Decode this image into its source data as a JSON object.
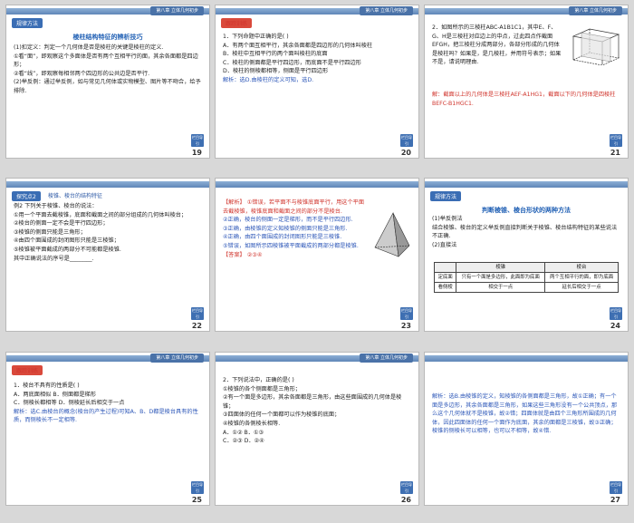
{
  "header_chapter": "第八章 立体几何初步",
  "slides": [
    {
      "tag": "规律方法",
      "title": "棱柱结构特征的辨析技巧",
      "lines": [
        "(1)扣定义：判定一个几何体是否是棱柱的关键是棱柱的定义.",
        "①看“面”，即观察这个多面体是否有两个互相平行的面，其余各面都是四边形；",
        "②看“线”，即观察每相邻两个四边形的公共边是否平行.",
        "(2)举反例：通过举反例，如与常见几何体或实物模型、图片等不吻合，给予排除."
      ],
      "back": "栏目导引",
      "page": "19"
    },
    {
      "tag": "跟踪训练",
      "lines": [
        "1．下列命题中正确的是(    )",
        "A．有两个面互相平行，其余各面都是四边形的几何体叫棱柱",
        "B．棱柱中互相平行的两个面叫棱柱的底面",
        "C．棱柱的侧面都是平行四边形，而底面不是平行四边形",
        "D．棱柱的侧棱都相等，侧面是平行四边形"
      ],
      "answer": "解析：选D.由棱柱的定义可知，选D.",
      "back": "栏目导引",
      "page": "20"
    },
    {
      "lines": [
        "2．如图所示的三棱柱ABC-A1B1C1，其中E、F、G、H是三棱柱对应边上的中点，过此四点作截面EFGH，把三棱柱分成两部分，各部分形成的几何体是棱柱吗？如果是，是几棱柱，并用符号表示；如果不是，请说明理由."
      ],
      "answer": "解：截面以上的几何体是三棱柱AEF-A1HG1，截面以下的几何体是四棱柱BEFC-B1HGC1.",
      "back": "栏目导引",
      "page": "21"
    },
    {
      "tag": "探究点2",
      "tag2": "棱锥、棱台的结构特征",
      "lines": [
        "例2  下列关于棱锥、棱台的说法：",
        "①用一个平面去截棱锥，底面和截面之间的部分组成的几何体叫棱台；",
        "②棱台的侧面一定不会是平行四边形；",
        "③棱锥的侧面只能是三角形；",
        "④由四个面围成的封闭图形只能是三棱锥；",
        "⑤棱锥被平面截成的两部分不可能都是棱锥.",
        "其中正确说法的序号是________."
      ],
      "back": "栏目导引",
      "page": "22"
    },
    {
      "lines": [
        "【解析】  ①错误，若平面不与棱锥底面平行，用这个平面去截棱锥，棱锥底面和截面之间的部分不是棱台.",
        "②正确，棱台的侧面一定是梯形，而不是平行四边形.",
        "③正确，由棱锥的定义知棱锥的侧面只能是三角形.",
        "④正确，由四个面围成的封闭图形只能是三棱锥.",
        "⑤错误，如图所示四棱锥被平面截成的两部分都是棱锥."
      ],
      "answer_label": "【答案】",
      "answer": "②③④",
      "back": "栏目导引",
      "page": "23"
    },
    {
      "tag": "规律方法",
      "title": "判断棱锥、棱台形状的两种方法",
      "lines": [
        "(1)举反例法",
        "结合棱锥、棱台的定义举反例直接判断关于棱锥、棱台结构特征的某些说法不正确.",
        "(2)直接法"
      ],
      "table": {
        "headers": [
          "",
          "棱锥",
          "棱台"
        ],
        "rows": [
          [
            "定底面",
            "只有一个面是多边形，此面即为底面",
            "两个互相平行的面，即为底面"
          ],
          [
            "看侧棱",
            "相交于一点",
            "延长后相交于一点"
          ]
        ]
      },
      "back": "栏目导引",
      "page": "24"
    },
    {
      "tag": "跟踪训练",
      "lines": [
        "1．棱台不具有的性质是(    )",
        "A．两底面相似          B．侧面都是梯形",
        "C．侧棱长都相等       D．侧棱延长后相交于一点"
      ],
      "answer": "解析：选C.由棱台的概念(棱台的产生过程)可知A、B、D都是棱台具有的性质，而侧棱长不一定相等.",
      "back": "栏目导引",
      "page": "25"
    },
    {
      "lines": [
        "2．下列说法中，正确的是(    )",
        "①棱锥的各个侧面都是三角形；",
        "②有一个面是多边形，其余各面都是三角形，由这些面围成的几何体是棱锥；",
        "③四面体的任何一个面都可以作为棱锥的底面；",
        "④棱锥的各侧棱长相等.",
        "A．①②          B．①③",
        "C．②③          D．②④"
      ],
      "back": "栏目导引",
      "page": "26"
    },
    {
      "answer": "解析：选B.由棱锥的定义，知棱锥的各侧面都是三角形，故①正确；有一个面是多边形，其余各面都是三角形，如果这些三角形没有一个公共顶点，那么这个几何体就不是棱锥，故②错；四面体就是由四个三角形所围成的几何体，因此四面体的任何一个面作为底面，其余的面都是三棱锥，故③正确；棱锥的侧棱长可以相等，也可以不相等，故④错.",
      "back": "栏目导引",
      "page": "27"
    }
  ]
}
